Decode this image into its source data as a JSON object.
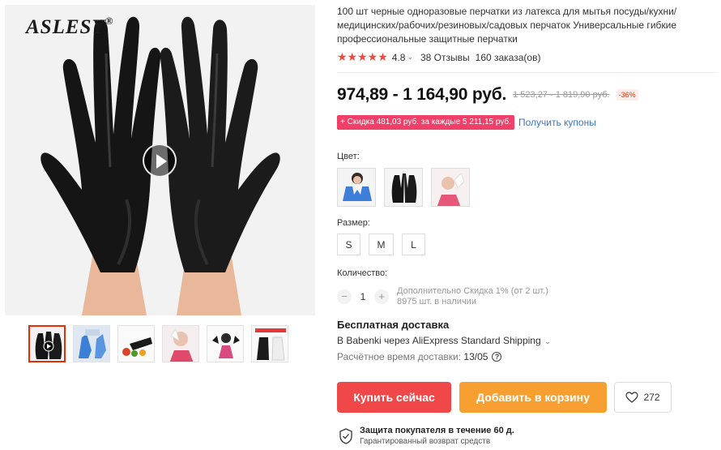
{
  "gallery": {
    "brand": "ASLESY",
    "brand_mark": "®",
    "thumbnails": [
      {
        "name": "thumb-black-gloves-video",
        "active": true
      },
      {
        "name": "thumb-blue-gloves",
        "active": false
      },
      {
        "name": "thumb-kitchen-gloves",
        "active": false
      },
      {
        "name": "thumb-white-gloves",
        "active": false
      },
      {
        "name": "thumb-gloves-model",
        "active": false
      },
      {
        "name": "thumb-black-white-gloves",
        "active": false
      }
    ]
  },
  "product": {
    "title": "100 шт черные одноразовые перчатки из латекса для мытья посуды/кухни/медицинских/рабочих/резиновых/садовых перчаток Универсальные гибкие профессиональные защитные перчатки",
    "rating": {
      "stars": "★★★★★",
      "value": "4.8",
      "reviews": "38 Отзывы",
      "orders": "160 заказа(ов)"
    },
    "price": "974,89 - 1 164,90 руб.",
    "old_price": "1 523,27 - 1 819,90 руб.",
    "discount": "-36%",
    "coupon": "+ Скидка 481,03 руб. за каждые 5 211,15 руб.",
    "coupon_link": "Получить купоны",
    "color_label": "Цвет:",
    "colors": [
      "blue",
      "black",
      "white"
    ],
    "size_label": "Размер:",
    "sizes": [
      "S",
      "M",
      "L"
    ],
    "quantity_label": "Количество:",
    "quantity": "1",
    "quantity_note_line1": "Дополнительно Скидка 1% (от 2 шт.)",
    "quantity_note_line2": "8975 шт. в наличии"
  },
  "shipping": {
    "title": "Бесплатная доставка",
    "method": "В Babenki через AliExpress Standard Shipping",
    "time_label": "Расчётное время доставки:",
    "time_value": "13/05"
  },
  "actions": {
    "buy": "Купить сейчас",
    "cart": "Добавить в корзину",
    "wishlist_count": "272"
  },
  "protection": {
    "title": "Защита покупателя в течение 60 д.",
    "subtitle": "Гарантированный возврат средств"
  },
  "colors": {
    "accent_red": "#f04848",
    "cart_orange": "#f7a031",
    "coupon_pink": "#f03f69",
    "star_red": "#f04a3e",
    "link_blue": "#3b75c6"
  }
}
